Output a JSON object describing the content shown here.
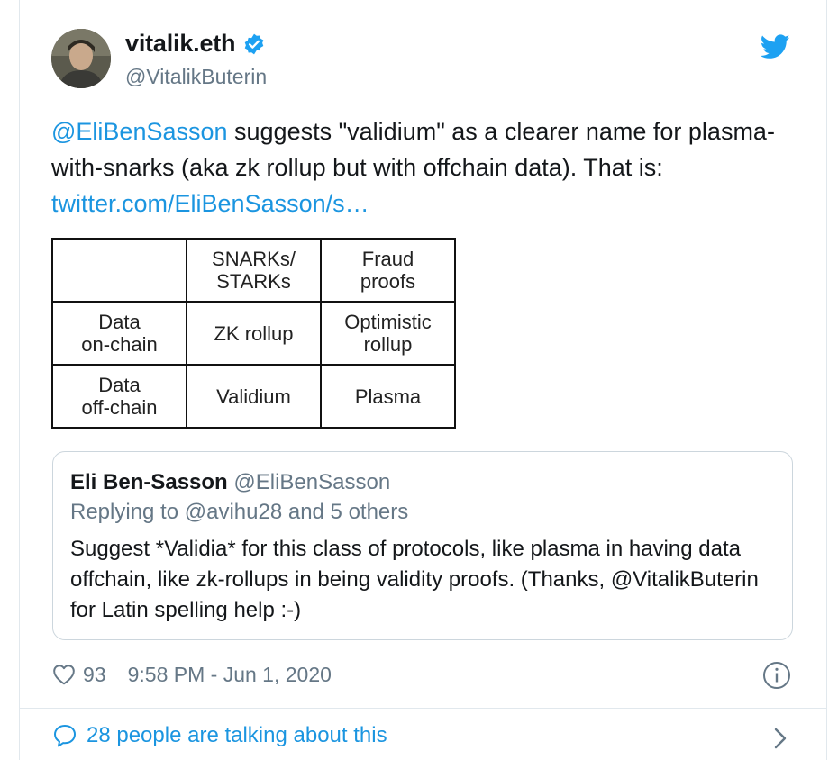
{
  "tweet": {
    "author": {
      "display_name": "vitalik.eth",
      "handle": "@VitalikButerin",
      "verified": true,
      "avatar_icon": "avatar-photo"
    },
    "logo_icon": "twitter-bird-icon",
    "text": {
      "mention": "@EliBenSasson",
      "body": " suggests \"validium\" as a clearer name for plasma-with-snarks (aka zk rollup but with offchain data). That is: ",
      "link": "twitter.com/EliBenSasson/s…"
    },
    "table": {
      "rows": [
        [
          "",
          "SNARKs/\nSTARKs",
          "Fraud\nproofs"
        ],
        [
          "Data\non-chain",
          "ZK rollup",
          "Optimistic\nrollup"
        ],
        [
          "Data\noff-chain",
          "Validium",
          "Plasma"
        ]
      ]
    },
    "quoted": {
      "name": "Eli Ben-Sasson",
      "handle": "@EliBenSasson",
      "replying": "Replying to @avihu28 and 5 others",
      "text": "Suggest *Validia* for this class of protocols, like plasma in having data offchain, like zk-rollups in being validity proofs. (Thanks, @VitalikButerin for Latin spelling help :-)"
    },
    "likes": "93",
    "timestamp": "9:58 PM - Jun 1, 2020",
    "talking": "28 people are talking about this"
  },
  "colors": {
    "link": "#1b95e0",
    "muted": "#657786",
    "border": "#e1e8ed"
  }
}
